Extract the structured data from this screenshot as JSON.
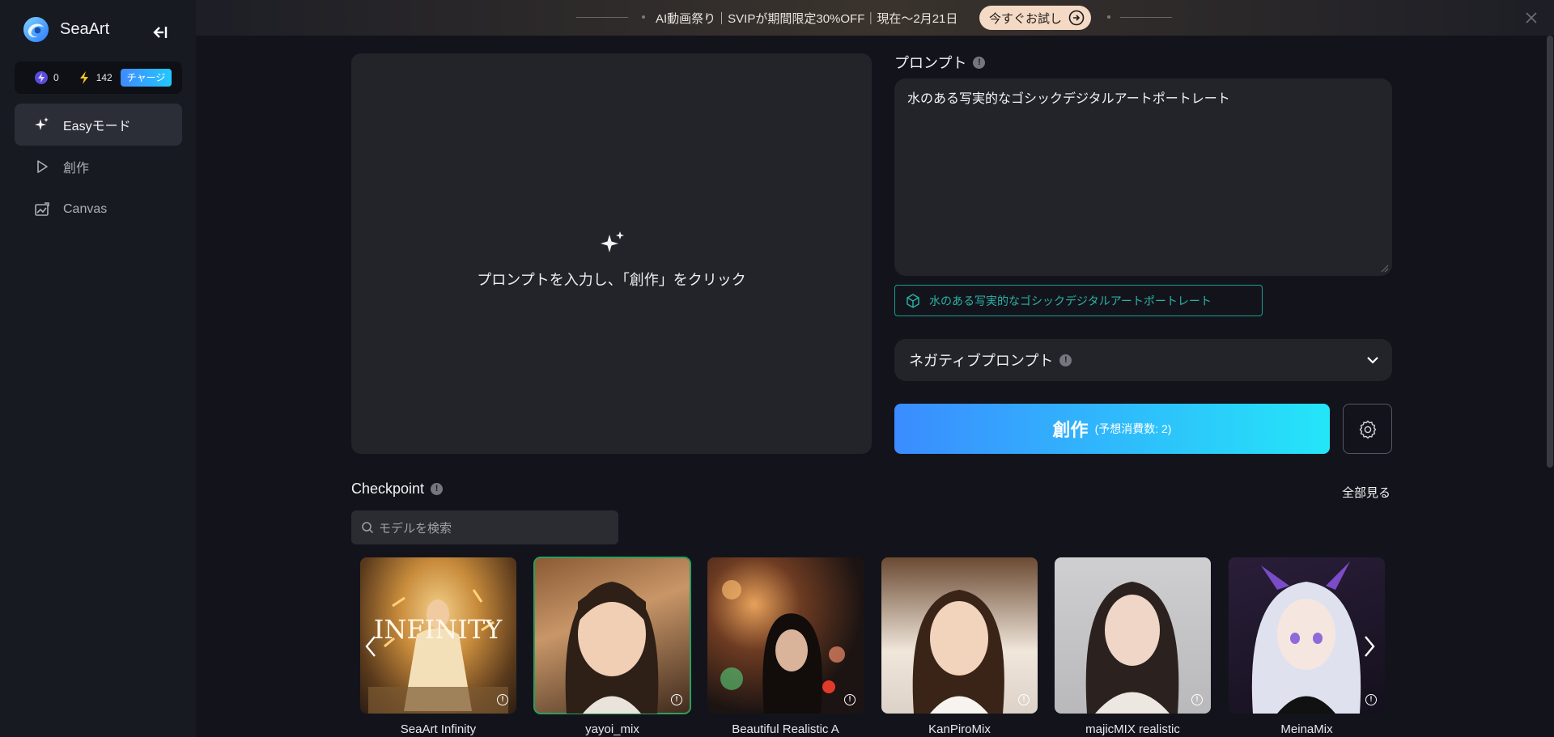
{
  "sidebar": {
    "brand": "SeaArt",
    "credits": {
      "stamina": "0",
      "energy": "142",
      "charge_label": "チャージ"
    },
    "items": [
      {
        "label": "Easyモード",
        "active": true
      },
      {
        "label": "創作",
        "active": false
      },
      {
        "label": "Canvas",
        "active": false
      }
    ]
  },
  "banner": {
    "text": "AI動画祭り｜SVIPが期間限定30%OFF｜現在～2月21日",
    "button_label": "今すぐお試し"
  },
  "preview": {
    "hint": "プロンプトを入力し、「創作」をクリック"
  },
  "prompt": {
    "label": "プロンプト",
    "value": "水のある写実的なゴシックデジタルアートポートレート",
    "suggestion": "水のある写実的なゴシックデジタルアートポートレート"
  },
  "negative": {
    "label": "ネガティブプロンプト"
  },
  "create": {
    "label": "創作",
    "cost": "(予想消費数: 2)"
  },
  "checkpoint": {
    "title": "Checkpoint",
    "see_all": "全部見る",
    "search_placeholder": "モデルを検索",
    "models": [
      {
        "name": "SeaArt Infinity",
        "overlay": "INFINITY"
      },
      {
        "name": "yayoi_mix"
      },
      {
        "name": "Beautiful Realistic A"
      },
      {
        "name": "KanPiroMix"
      },
      {
        "name": "majicMIX realistic"
      },
      {
        "name": "MeinaMix"
      }
    ]
  },
  "colors": {
    "accent_start": "#3b8cff",
    "accent_end": "#24e6f8",
    "suggestion": "#2ab3a8"
  }
}
